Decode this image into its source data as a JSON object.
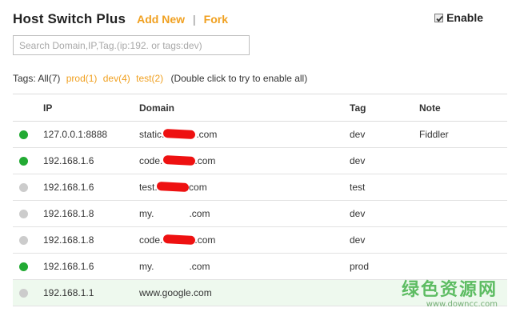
{
  "header": {
    "title": "Host Switch Plus",
    "add_new": "Add New",
    "separator": "|",
    "fork": "Fork",
    "enable_label": "Enable",
    "enabled": true
  },
  "search": {
    "placeholder": "Search Domain,IP,Tag.(ip:192. or tags:dev)",
    "value": ""
  },
  "tags": {
    "label": "Tags:",
    "all": "All(7)",
    "items": [
      "prod(1)",
      "dev(4)",
      "test(2)"
    ],
    "hint": "(Double click to try to enable all)"
  },
  "table": {
    "columns": [
      "IP",
      "Domain",
      "Tag",
      "Note"
    ],
    "rows": [
      {
        "enabled": true,
        "ip": "127.0.0.1:8888",
        "domain": "static.",
        "domain_suffix": ".com",
        "tag": "dev",
        "note": "Fiddler"
      },
      {
        "enabled": true,
        "ip": "192.168.1.6",
        "domain": "code.",
        "domain_suffix": ".com",
        "tag": "dev",
        "note": ""
      },
      {
        "enabled": false,
        "ip": "192.168.1.6",
        "domain": "test.",
        "domain_suffix": ".com",
        "tag": "test",
        "note": ""
      },
      {
        "enabled": false,
        "ip": "192.168.1.8",
        "domain": "my.",
        "domain_suffix": ".com",
        "tag": "dev",
        "note": ""
      },
      {
        "enabled": false,
        "ip": "192.168.1.8",
        "domain": "code.",
        "domain_suffix": ".com",
        "tag": "dev",
        "note": ""
      },
      {
        "enabled": true,
        "ip": "192.168.1.6",
        "domain": "my.",
        "domain_suffix": ".com",
        "tag": "prod",
        "note": ""
      },
      {
        "enabled": false,
        "ip": "192.168.1.1",
        "domain": "www.google.com",
        "domain_suffix": "",
        "tag": "",
        "note": ""
      }
    ]
  },
  "colors": {
    "accent": "#f0a020",
    "enabled_dot": "#22aa33",
    "disabled_dot": "#cccccc",
    "redaction": "#ee1111",
    "highlight_row": "#eef9ee"
  },
  "watermark": {
    "text_cn": "绿色资源网",
    "url": "www.downcc.com"
  }
}
